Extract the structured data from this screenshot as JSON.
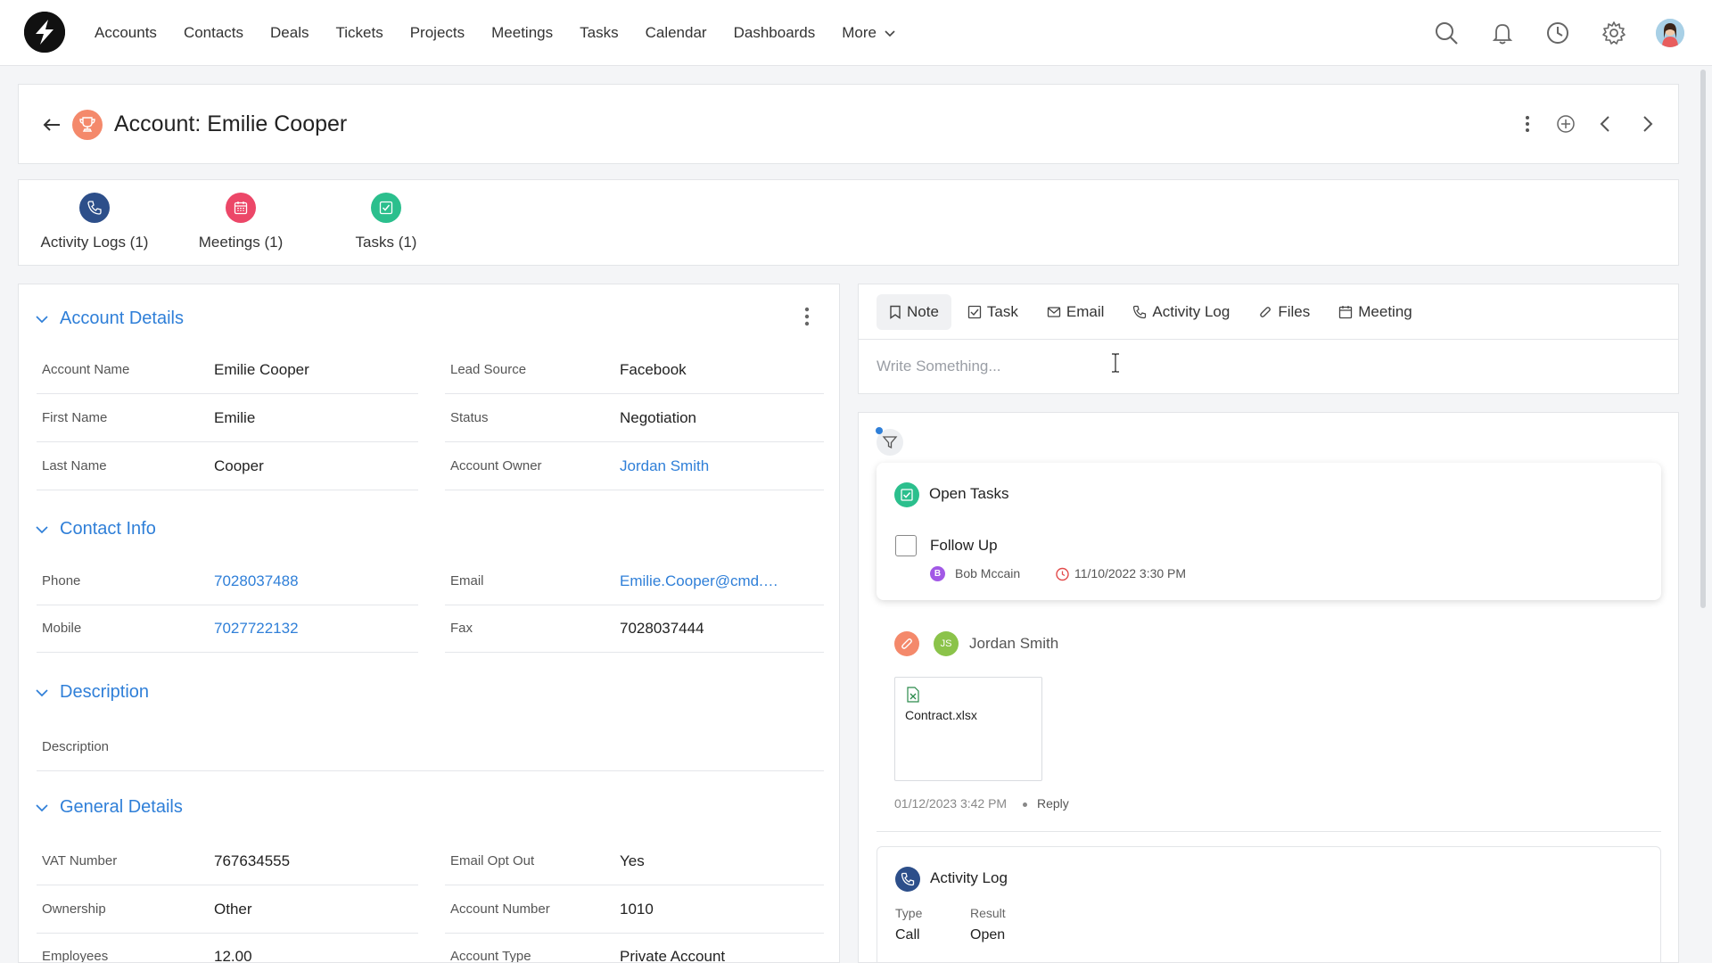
{
  "nav": {
    "items": [
      "Accounts",
      "Contacts",
      "Deals",
      "Tickets",
      "Projects",
      "Meetings",
      "Tasks",
      "Calendar",
      "Dashboards"
    ],
    "more_label": "More",
    "icons": [
      "search-icon",
      "bell-icon",
      "clock-icon",
      "gear-icon",
      "user-avatar"
    ]
  },
  "header": {
    "title": "Account: Emilie Cooper",
    "icon": "trophy-icon"
  },
  "related": [
    {
      "label": "Activity Logs (1)",
      "icon": "phone-icon",
      "color": "#2d4f8a"
    },
    {
      "label": "Meetings (1)",
      "icon": "calendar-icon",
      "color": "#ec4768"
    },
    {
      "label": "Tasks (1)",
      "icon": "checkbox-icon",
      "color": "#2bbf8d"
    }
  ],
  "sections": {
    "account_details": "Account Details",
    "contact_info": "Contact Info",
    "description": "Description",
    "general_details": "General Details"
  },
  "fields": {
    "account_name": {
      "label": "Account Name",
      "value": "Emilie Cooper"
    },
    "lead_source": {
      "label": "Lead Source",
      "value": "Facebook"
    },
    "first_name": {
      "label": "First Name",
      "value": "Emilie"
    },
    "status": {
      "label": "Status",
      "value": "Negotiation"
    },
    "last_name": {
      "label": "Last Name",
      "value": "Cooper"
    },
    "account_owner": {
      "label": "Account Owner",
      "value": "Jordan Smith"
    },
    "phone": {
      "label": "Phone",
      "value": "7028037488"
    },
    "email": {
      "label": "Email",
      "value": "Emilie.Cooper@cmd.…"
    },
    "mobile": {
      "label": "Mobile",
      "value": "7027722132"
    },
    "fax": {
      "label": "Fax",
      "value": "7028037444"
    },
    "description": {
      "label": "Description",
      "value": ""
    },
    "vat_number": {
      "label": "VAT Number",
      "value": "767634555"
    },
    "email_opt_out": {
      "label": "Email Opt Out",
      "value": "Yes"
    },
    "ownership": {
      "label": "Ownership",
      "value": "Other"
    },
    "account_number": {
      "label": "Account Number",
      "value": "1010"
    },
    "employees": {
      "label": "Employees",
      "value": "12.00"
    },
    "account_type": {
      "label": "Account Type",
      "value": "Private Account"
    }
  },
  "composer": {
    "tabs": [
      "Note",
      "Task",
      "Email",
      "Activity Log",
      "Files",
      "Meeting"
    ],
    "active_tab": "Note",
    "placeholder": "Write Something..."
  },
  "feed": {
    "open_tasks": {
      "title": "Open Tasks",
      "task": "Follow Up",
      "assignee_initial": "B",
      "assignee": "Bob Mccain",
      "due": "11/10/2022 3:30 PM"
    },
    "post": {
      "author_initials": "JS",
      "author": "Jordan Smith",
      "file": "Contract.xlsx",
      "date": "01/12/2023 3:42 PM",
      "reply_label": "Reply"
    },
    "activity": {
      "title": "Activity Log",
      "type_label": "Type",
      "type_value": "Call",
      "result_label": "Result",
      "result_value": "Open"
    }
  },
  "colors": {
    "accent": "#2f7fd8",
    "trophy": "#f4896b",
    "activity": "#2d4f8a",
    "meetings": "#ec4768",
    "tasks": "#2bbf8d"
  }
}
